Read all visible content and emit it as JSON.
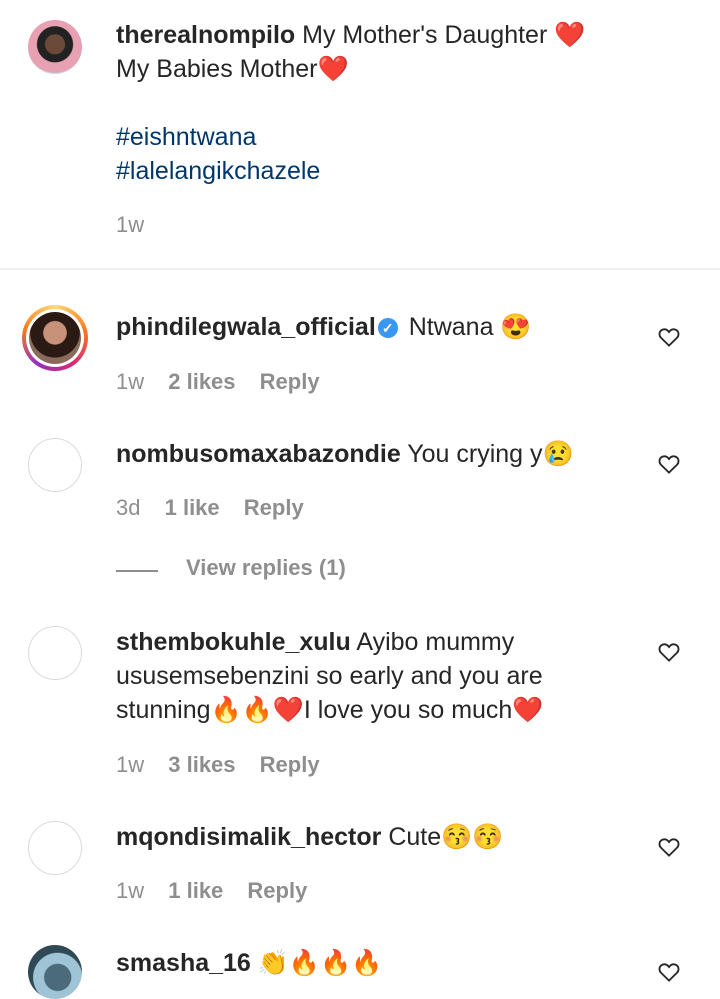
{
  "caption": {
    "username": "therealnompilo",
    "line1": "My Mother's Daughter ❤️",
    "line2": "My Babies Mother❤️",
    "hashtag1": "#eishntwana",
    "hashtag2": "#lalelangikchazele",
    "time": "1w"
  },
  "comments": [
    {
      "username": "phindilegwala_official",
      "verified": true,
      "text": "Ntwana 😍",
      "time": "1w",
      "likes": "2 likes",
      "reply": "Reply"
    },
    {
      "username": "nombusomaxabazondie",
      "text": "You crying y😢",
      "time": "3d",
      "likes": "1 like",
      "reply": "Reply",
      "view_replies": "View replies (1)"
    },
    {
      "username": "sthembokuhle_xulu",
      "text_line1": "Ayibo mummy",
      "text_line2": "ususemsebenzini so early and you are",
      "text_line3": "stunning🔥🔥❤️I love you so much❤️",
      "time": "1w",
      "likes": "3 likes",
      "reply": "Reply"
    },
    {
      "username": "mqondisimalik_hector",
      "text": "Cute😚😚",
      "time": "1w",
      "likes": "1 like",
      "reply": "Reply"
    },
    {
      "username": "smasha_16",
      "text": "👏🔥🔥🔥"
    }
  ],
  "icons": {
    "like": "heart-outline-icon",
    "verified": "verified-badge-icon"
  },
  "colors": {
    "hashtag": "#00376b",
    "secondary": "#8e8e8e",
    "verified": "#3897f0"
  }
}
